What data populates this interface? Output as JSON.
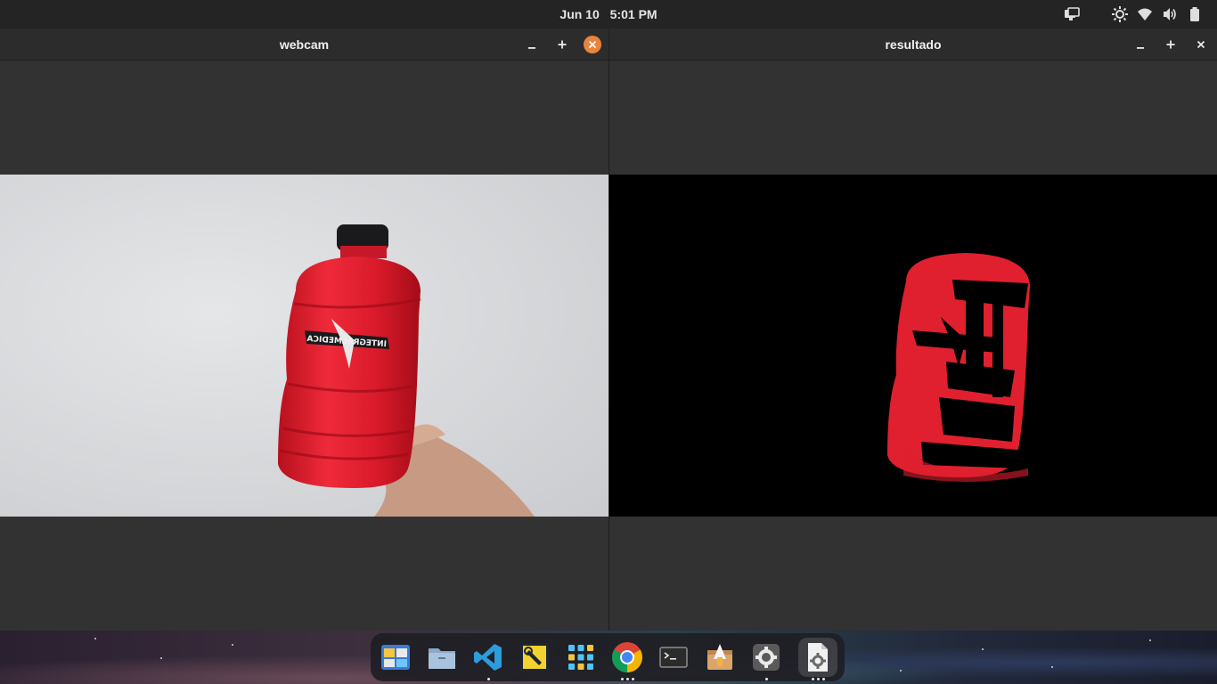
{
  "topbar": {
    "date": "Jun 10",
    "time": "5:01 PM",
    "tray_icons": [
      "screen-share-icon",
      "brightness-icon",
      "wifi-icon",
      "volume-icon",
      "battery-icon"
    ]
  },
  "windows": [
    {
      "title": "webcam",
      "active": true
    },
    {
      "title": "resultado",
      "active": false
    }
  ],
  "webcam_view": {
    "bottle_label": "INTEGRALMEDICA"
  },
  "dock": {
    "apps": [
      {
        "name": "workspaces",
        "icon": "workspaces-icon",
        "running_dots": 0
      },
      {
        "name": "files",
        "icon": "folder-icon",
        "running_dots": 0
      },
      {
        "name": "vscode",
        "icon": "vscode-icon",
        "running_dots": 1
      },
      {
        "name": "tweaks",
        "icon": "tweaks-icon",
        "running_dots": 0
      },
      {
        "name": "applications",
        "icon": "app-grid-icon",
        "running_dots": 0
      },
      {
        "name": "chrome",
        "icon": "chrome-icon",
        "running_dots": 3
      },
      {
        "name": "terminal",
        "icon": "terminal-icon",
        "running_dots": 0
      },
      {
        "name": "installer",
        "icon": "installer-icon",
        "running_dots": 0
      },
      {
        "name": "settings",
        "icon": "settings-icon",
        "running_dots": 1
      },
      {
        "name": "document-settings",
        "icon": "document-gear-icon",
        "running_dots": 3
      }
    ]
  },
  "colors": {
    "close_active": "#e8843e",
    "bottle_red": "#e0202e",
    "window_bg": "#323232",
    "titlebar_bg": "#2c2c2c"
  }
}
